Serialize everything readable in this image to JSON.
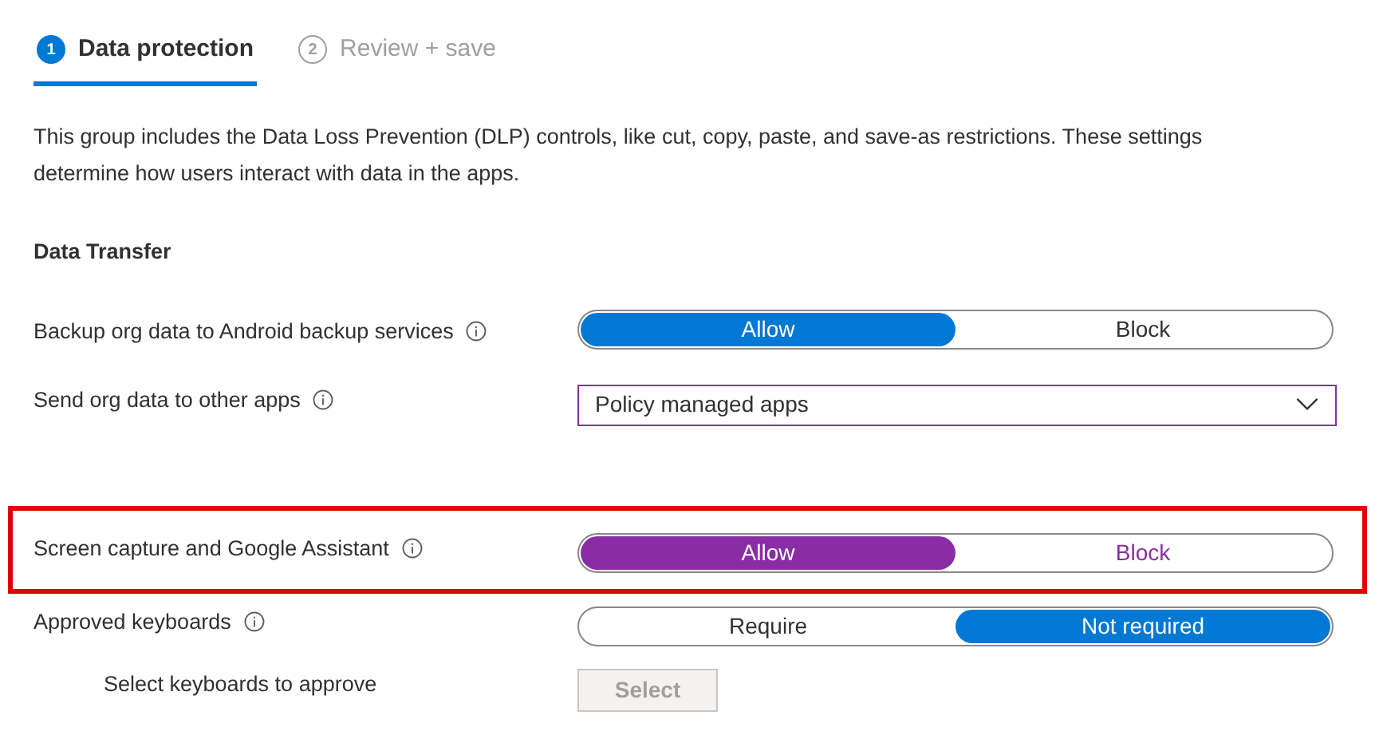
{
  "steps": [
    {
      "number": "1",
      "label": "Data protection",
      "selected": true
    },
    {
      "number": "2",
      "label": "Review + save",
      "selected": false
    }
  ],
  "description": "This group includes the Data Loss Prevention (DLP) controls, like cut, copy, paste, and save-as restrictions. These settings determine how users interact with data in the apps.",
  "section_title": "Data Transfer",
  "settings": [
    {
      "kind": "toggle",
      "label": "Backup org data to Android backup services",
      "info": true,
      "options": [
        {
          "label": "Allow",
          "selected": true
        },
        {
          "label": "Block",
          "selected": false
        }
      ]
    },
    {
      "kind": "dropdown",
      "label": "Send org data to other apps",
      "info": true,
      "value": "Policy managed apps"
    },
    {
      "kind": "toggle",
      "label": "Screen capture and Google Assistant",
      "info": true,
      "highlighted": true,
      "options": [
        {
          "label": "Allow",
          "selected": true
        },
        {
          "label": "Block",
          "selected": false
        }
      ]
    },
    {
      "kind": "toggle",
      "label": "Approved keyboards",
      "info": true,
      "options": [
        {
          "label": "Require",
          "selected": false
        },
        {
          "label": "Not required",
          "selected": true
        }
      ],
      "children": [
        {
          "kind": "button",
          "label": "Select keyboards to approve",
          "button": "Select",
          "disabled": true
        }
      ]
    }
  ]
}
